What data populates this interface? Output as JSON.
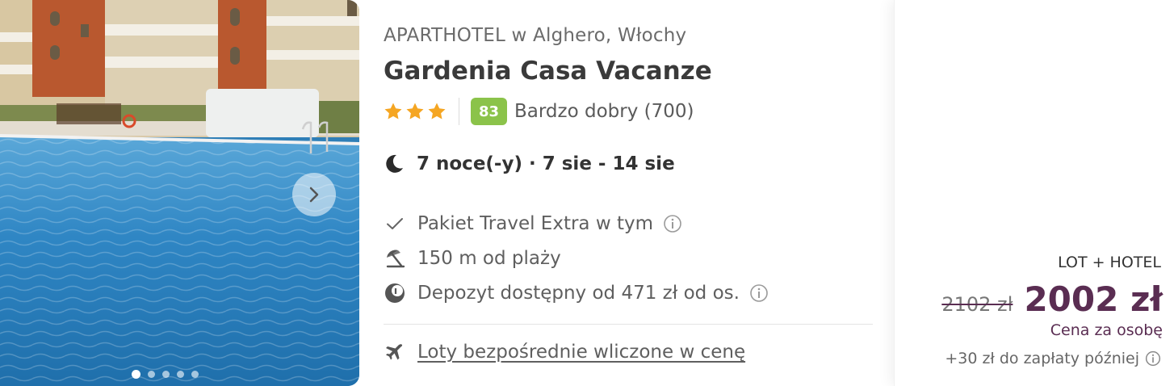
{
  "hotel": {
    "category_location": "APARTHOTEL w Alghero, Włochy",
    "name": "Gardenia Casa Vacanze",
    "stars": 3,
    "score": "83",
    "score_label": "Bardzo dobry (700)",
    "score_color": "#8bc34a",
    "star_color": "#f5a623"
  },
  "stay": {
    "icon": "moon-icon",
    "text": "7 noce(-y) · 7 sie - 14 sie"
  },
  "features": [
    {
      "icon": "check-icon",
      "text": "Pakiet Travel Extra w tym",
      "info": true
    },
    {
      "icon": "beach-umbrella-icon",
      "text": "150 m od plaży",
      "info": false
    },
    {
      "icon": "deposit-icon",
      "text": "Depozyt dostępny od 471 zł od os.",
      "info": true
    }
  ],
  "flight": {
    "icon": "airplane-icon",
    "text": "Loty bezpośrednie wliczone w cenę"
  },
  "gallery": {
    "slides": 5,
    "active_slide": 1
  },
  "price": {
    "package": "LOT + HOTEL",
    "old": "2102 zł",
    "current": "2002 zł",
    "per_person": "Cena za osobę",
    "pay_later": "+30 zł do zapłaty później",
    "brand_color": "#5a2d52"
  }
}
